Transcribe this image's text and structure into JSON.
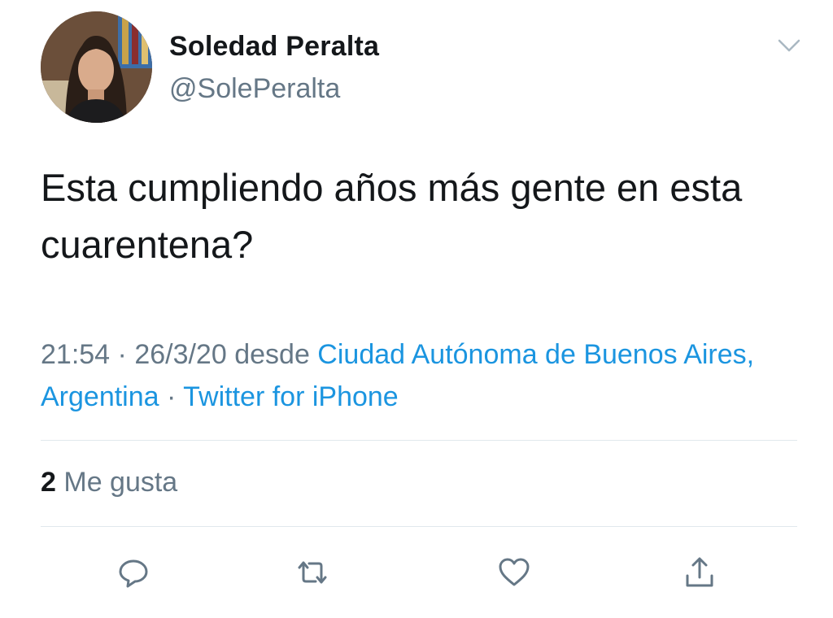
{
  "author": {
    "name": "Soledad Peralta",
    "handle": "@SolePeralta"
  },
  "tweet": {
    "text": "Esta cumpliendo años más gente en esta cuarentena?",
    "time": "21:54",
    "separator": " · ",
    "date": "26/3/20",
    "from_word": " desde ",
    "location": "Ciudad Autónoma de Buenos Aires, Argentina",
    "source": "Twitter for iPhone"
  },
  "stats": {
    "likes_count": "2",
    "likes_label": " Me gusta"
  },
  "actions": {
    "reply": "reply-icon",
    "retweet": "retweet-icon",
    "like": "heart-icon",
    "share": "share-icon"
  },
  "colors": {
    "link": "#1b95e0",
    "secondary": "#657786",
    "text": "#14171a",
    "divider": "#e1e8ed"
  }
}
